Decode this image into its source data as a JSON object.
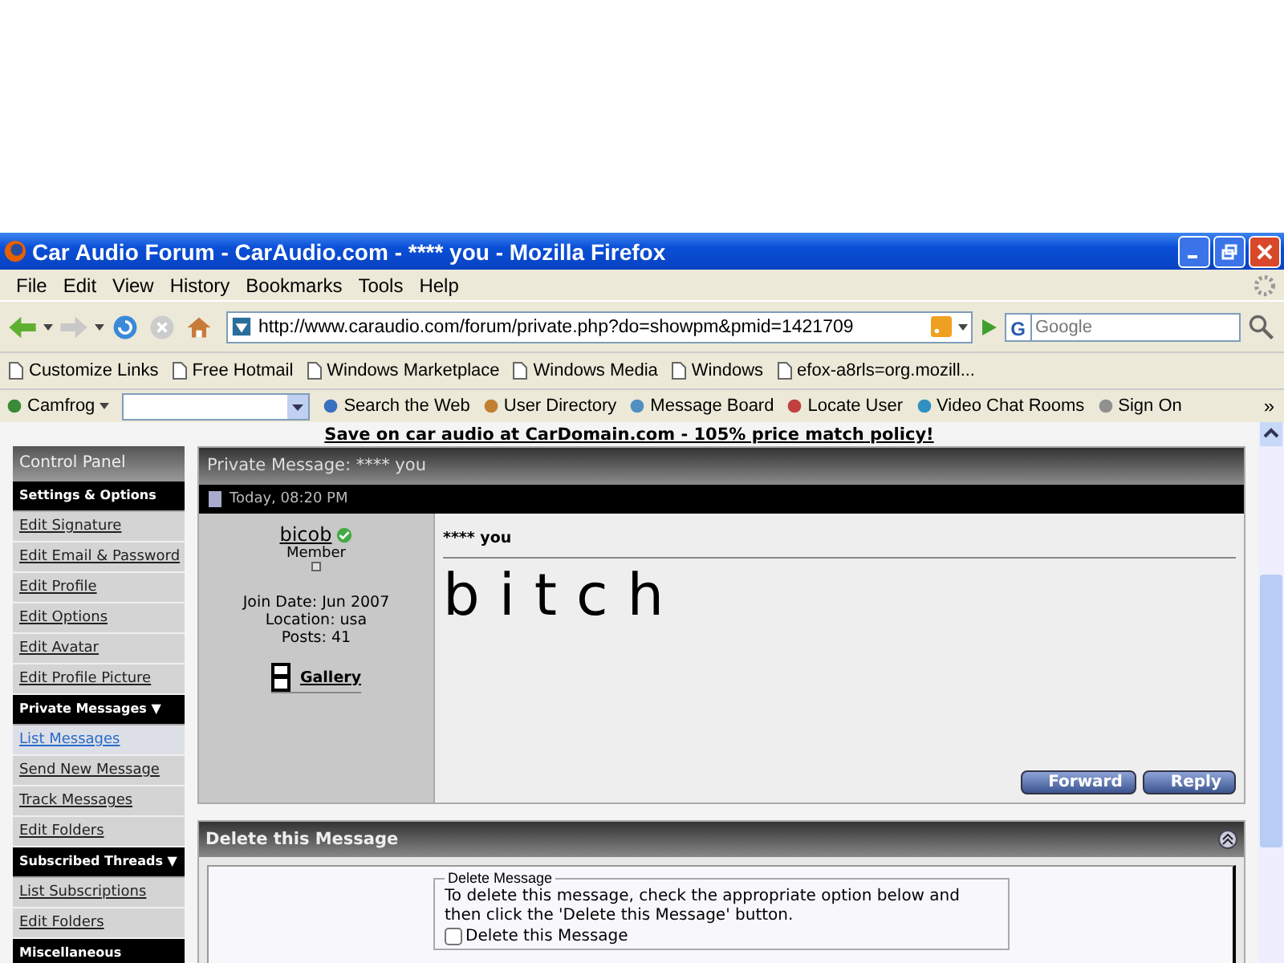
{
  "window": {
    "title": "Car Audio Forum - CarAudio.com - **** you - Mozilla Firefox"
  },
  "menu": [
    "File",
    "Edit",
    "View",
    "History",
    "Bookmarks",
    "Tools",
    "Help"
  ],
  "navigation": {
    "url": "http://www.caraudio.com/forum/private.php?do=showpm&pmid=1421709",
    "search_engine": "G",
    "search_placeholder": "Google"
  },
  "bookmarks": [
    "Customize Links",
    "Free Hotmail",
    "Windows Marketplace",
    "Windows Media",
    "Windows",
    "efox-a8rls=org.mozill..."
  ],
  "camfrog_toolbar": {
    "brand": "Camfrog",
    "items": [
      "Search the Web",
      "User Directory",
      "Message Board",
      "Locate User",
      "Video Chat Rooms",
      "Sign On"
    ],
    "more": "»"
  },
  "page": {
    "banner": "Save on car audio at CarDomain.com - 105% price match policy!",
    "sidebar": [
      {
        "kind": "header",
        "label": "Control Panel"
      },
      {
        "kind": "section",
        "label": "Settings & Options"
      },
      {
        "kind": "link",
        "label": "Edit Signature",
        "selected": false
      },
      {
        "kind": "link",
        "label": "Edit Email & Password",
        "selected": false
      },
      {
        "kind": "link",
        "label": "Edit Profile",
        "selected": false
      },
      {
        "kind": "link",
        "label": "Edit Options",
        "selected": false
      },
      {
        "kind": "link",
        "label": "Edit Avatar",
        "selected": false
      },
      {
        "kind": "link",
        "label": "Edit Profile Picture",
        "selected": false
      },
      {
        "kind": "section",
        "label": "Private Messages ▼"
      },
      {
        "kind": "link",
        "label": "List Messages",
        "selected": true
      },
      {
        "kind": "link",
        "label": "Send New Message",
        "selected": false
      },
      {
        "kind": "link",
        "label": "Track Messages",
        "selected": false
      },
      {
        "kind": "link",
        "label": "Edit Folders",
        "selected": false
      },
      {
        "kind": "section",
        "label": "Subscribed Threads ▼"
      },
      {
        "kind": "link",
        "label": "List Subscriptions",
        "selected": false
      },
      {
        "kind": "link",
        "label": "Edit Folders",
        "selected": false
      },
      {
        "kind": "section",
        "label": "Miscellaneous"
      }
    ],
    "message": {
      "title": "Private Message: **** you",
      "date": "Today, 08:20 PM",
      "sender": {
        "name": "bicob",
        "online": true,
        "rank": "Member",
        "join_date": "Join Date: Jun 2007",
        "location": "Location: usa",
        "posts": "Posts: 41",
        "gallery": "Gallery"
      },
      "subject": "**** you",
      "body": "bitch",
      "buttons": [
        "Forward",
        "Reply"
      ]
    },
    "delete_panel": {
      "title": "Delete this Message",
      "legend": "Delete Message",
      "text": "To delete this message, check the appropriate option below and then click the 'Delete this Message' button.",
      "checkbox": {
        "label": "Delete this Message",
        "checked": false
      }
    }
  }
}
